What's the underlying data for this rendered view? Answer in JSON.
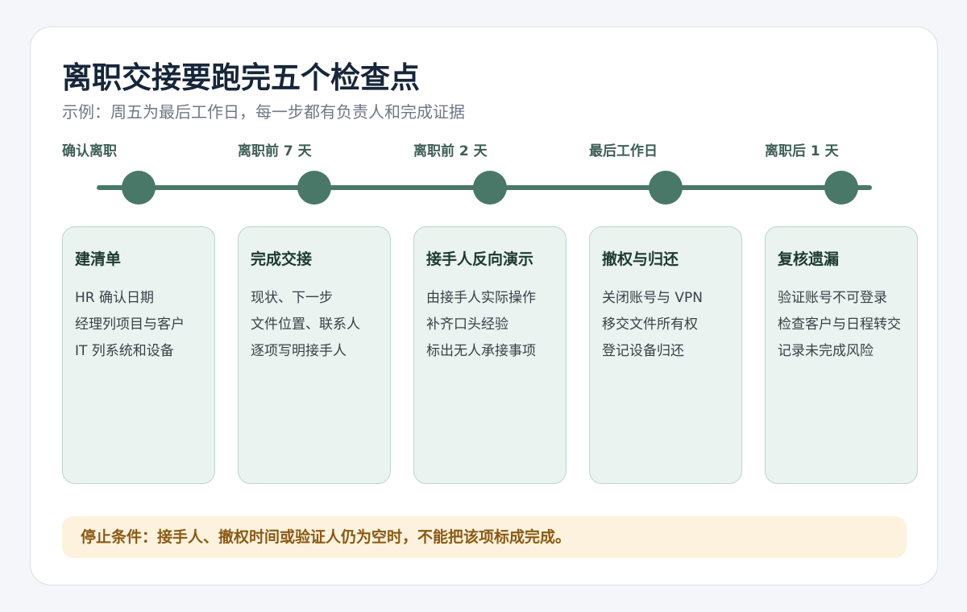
{
  "title": "离职交接要跑完五个检查点",
  "subtitle": "示例：周五为最后工作日，每一步都有负责人和完成证据",
  "stages": [
    {
      "label": "确认离职",
      "title": "建清单",
      "items": [
        "HR 确认日期",
        "经理列项目与客户",
        "IT 列系统和设备"
      ]
    },
    {
      "label": "离职前 7 天",
      "title": "完成交接",
      "items": [
        "现状、下一步",
        "文件位置、联系人",
        "逐项写明接手人"
      ]
    },
    {
      "label": "离职前 2 天",
      "title": "接手人反向演示",
      "items": [
        "由接手人实际操作",
        "补齐口头经验",
        "标出无人承接事项"
      ]
    },
    {
      "label": "最后工作日",
      "title": "撤权与归还",
      "items": [
        "关闭账号与 VPN",
        "移交文件所有权",
        "登记设备归还"
      ]
    },
    {
      "label": "离职后 1 天",
      "title": "复核遗漏",
      "items": [
        "验证账号不可登录",
        "检查客户与日程转交",
        "记录未完成风险"
      ]
    }
  ],
  "stop_condition": "停止条件：接手人、撤权时间或验证人仍为空时，不能把该项标成完成。",
  "colors": {
    "accent": "#4a7868",
    "card_bg": "#eaf3ef",
    "card_border": "#bcd6cb",
    "warning_bg": "#fdf2de",
    "warning_text": "#8a5a14"
  }
}
